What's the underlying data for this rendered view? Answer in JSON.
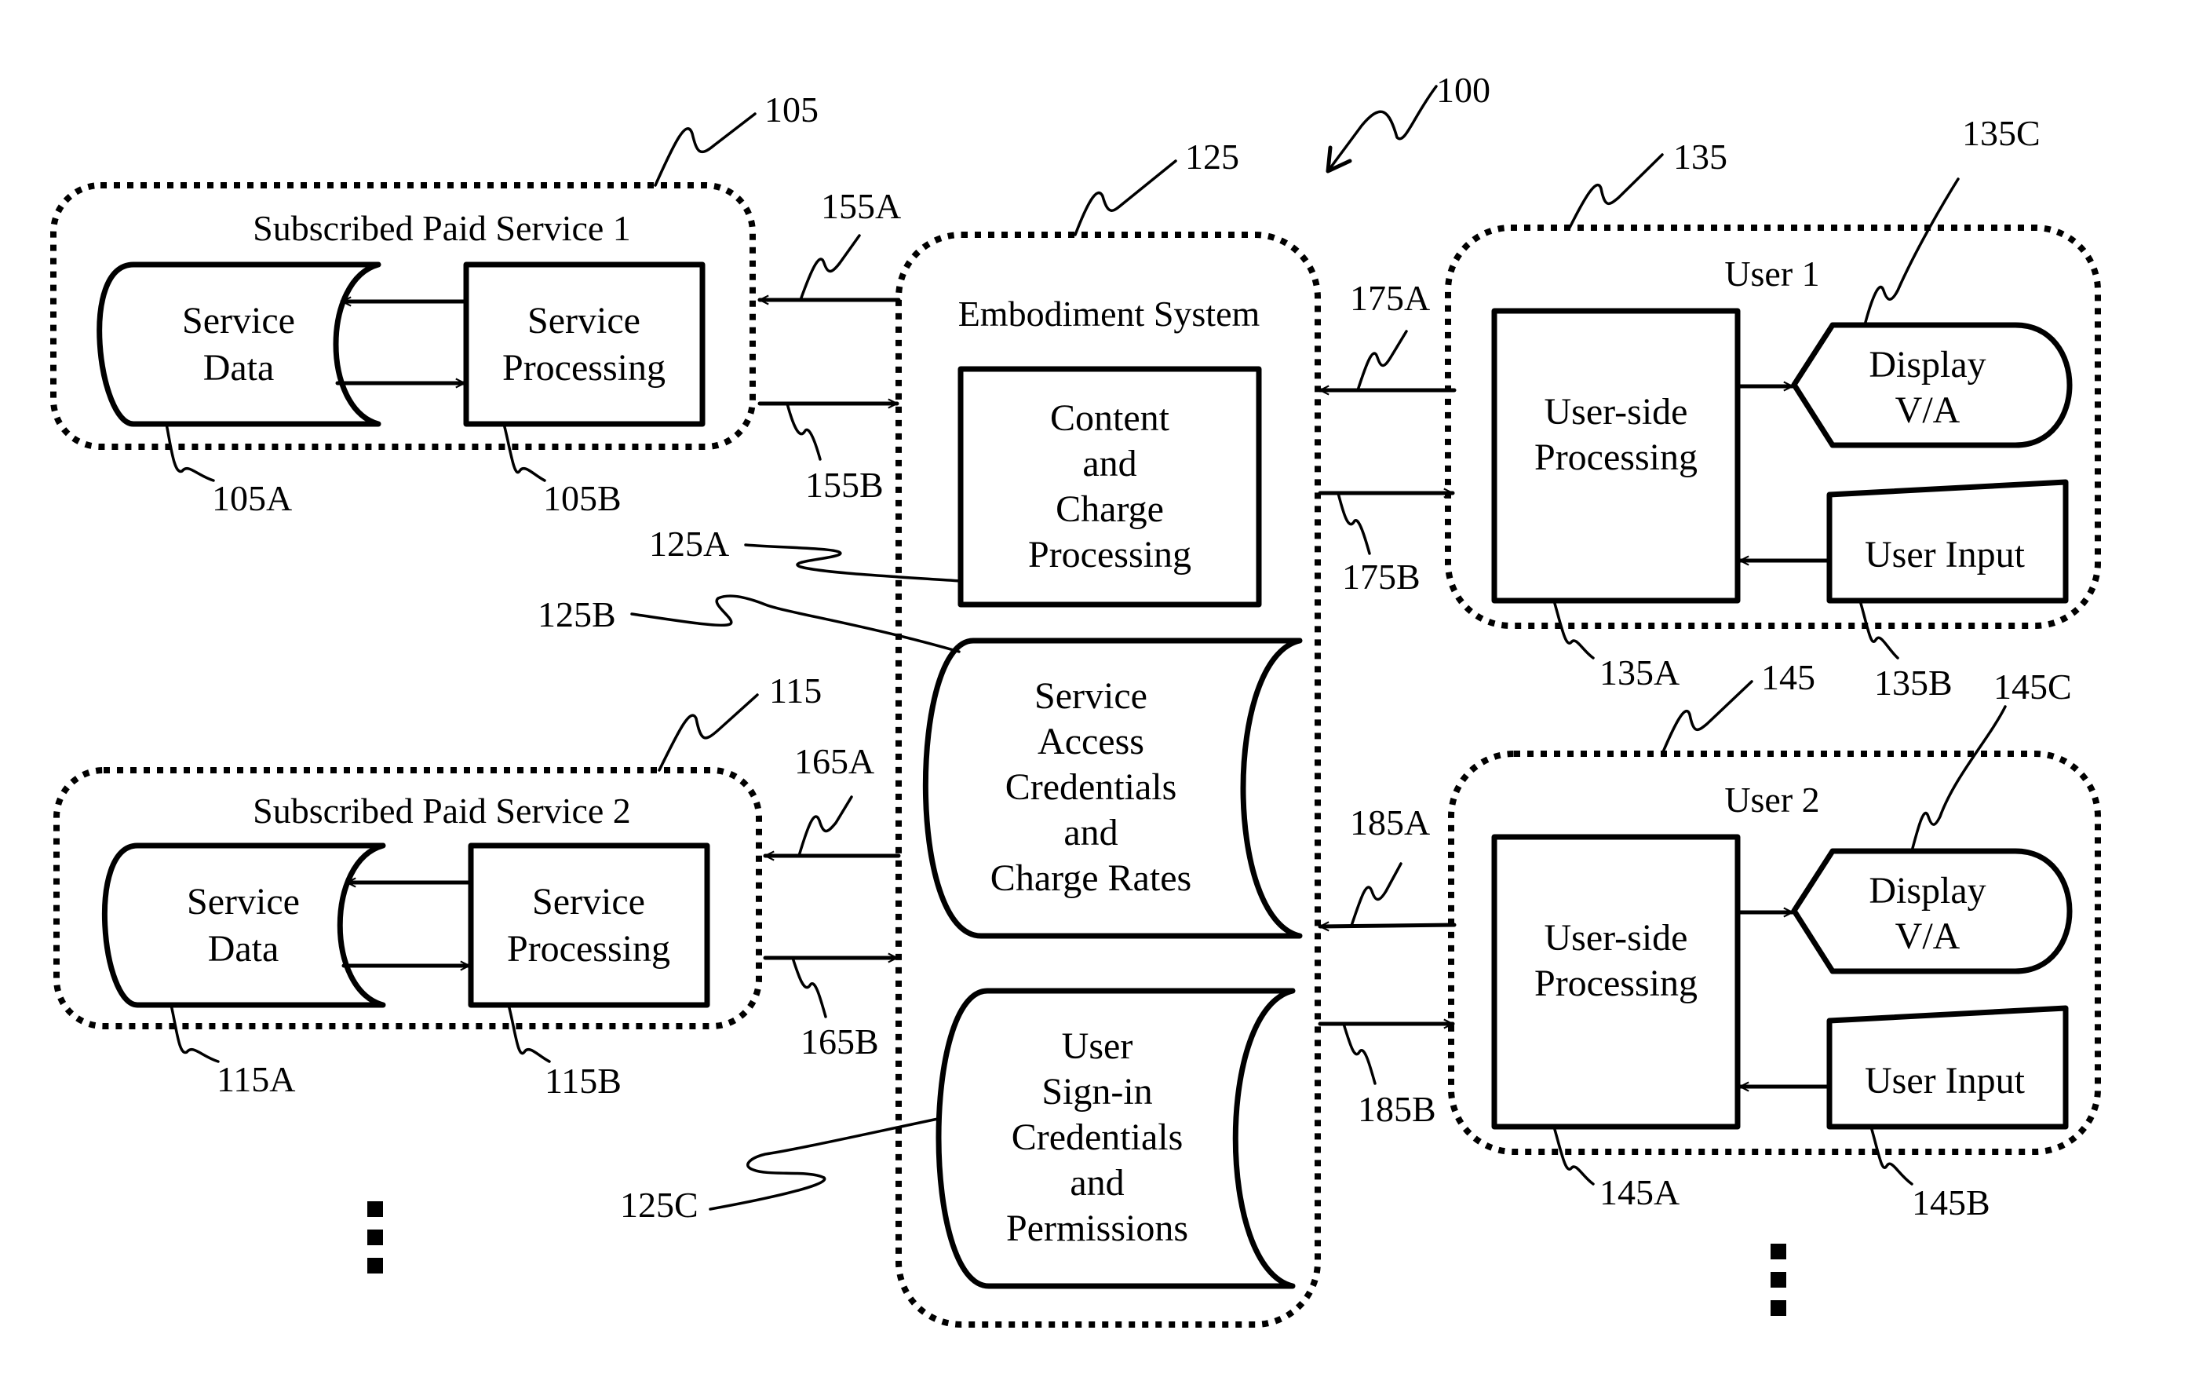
{
  "figure": {
    "ref_system": "100"
  },
  "service1": {
    "ref": "105",
    "title": "Subscribed Paid Service 1",
    "data_store": {
      "ref": "105A",
      "lines": [
        "Service",
        "Data"
      ]
    },
    "processing": {
      "ref": "105B",
      "lines": [
        "Service",
        "Processing"
      ]
    },
    "link_out": "155A",
    "link_in": "155B"
  },
  "service2": {
    "ref": "115",
    "title": "Subscribed Paid Service 2",
    "data_store": {
      "ref": "115A",
      "lines": [
        "Service",
        "Data"
      ]
    },
    "processing": {
      "ref": "115B",
      "lines": [
        "Service",
        "Processing"
      ]
    },
    "link_out": "165A",
    "link_in": "165B"
  },
  "embodiment": {
    "ref": "125",
    "title": "Embodiment System",
    "content_charge": {
      "ref": "125A",
      "lines": [
        "Content",
        "and",
        "Charge",
        "Processing"
      ]
    },
    "access_store": {
      "ref": "125B",
      "lines": [
        "Service",
        "Access",
        "Credentials",
        "and",
        "Charge Rates"
      ]
    },
    "signin_store": {
      "ref": "125C",
      "lines": [
        "User",
        "Sign-in",
        "Credentials",
        "and",
        "Permissions"
      ]
    }
  },
  "user1": {
    "ref": "135",
    "title": "User 1",
    "processing": {
      "ref": "135A",
      "lines": [
        "User-side",
        "Processing"
      ]
    },
    "input": {
      "ref": "135B",
      "label": "User Input"
    },
    "display": {
      "ref": "135C",
      "lines": [
        "Display",
        "V/A"
      ]
    },
    "link_in": "175A",
    "link_out": "175B"
  },
  "user2": {
    "ref": "145",
    "title": "User 2",
    "processing": {
      "ref": "145A",
      "lines": [
        "User-side",
        "Processing"
      ]
    },
    "input": {
      "ref": "145B",
      "label": "User Input"
    },
    "display": {
      "ref": "145C",
      "lines": [
        "Display",
        "V/A"
      ]
    },
    "link_in": "185A",
    "link_out": "185B"
  },
  "continuation": {
    "services_more": "more-services-ellipsis",
    "users_more": "more-users-ellipsis"
  }
}
